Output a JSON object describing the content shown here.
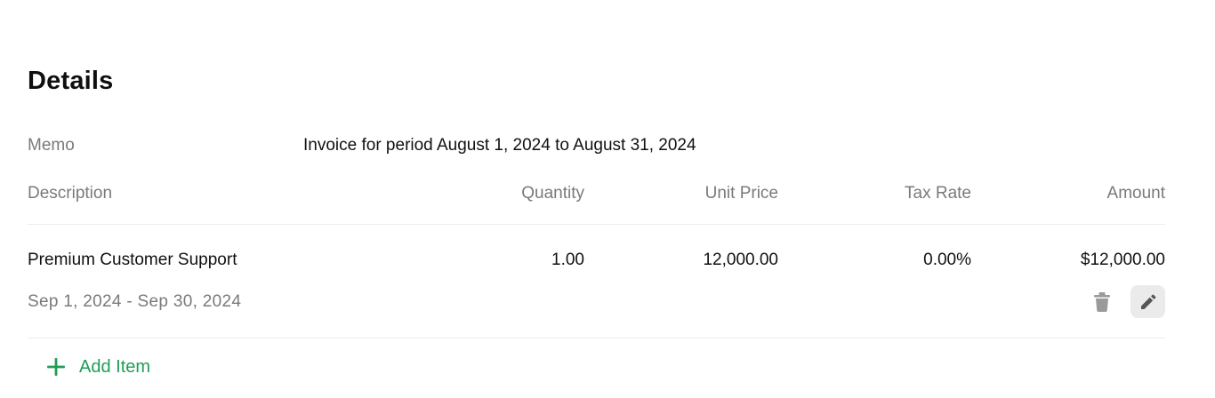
{
  "details": {
    "title": "Details",
    "memo_label": "Memo",
    "memo_value": "Invoice for period August 1, 2024 to August 31, 2024"
  },
  "table": {
    "columns": [
      "Description",
      "Quantity",
      "Unit Price",
      "Tax Rate",
      "Amount"
    ],
    "rows": [
      {
        "description": "Premium Customer Support",
        "quantity": "1.00",
        "unit_price": "12,000.00",
        "tax_rate": "0.00%",
        "amount": "$12,000.00",
        "period": "Sep 1, 2024 - Sep 30, 2024"
      }
    ]
  },
  "actions": {
    "delete_icon": "trash-icon",
    "edit_icon": "pencil-icon",
    "add_item_icon": "plus-icon",
    "add_item_label": "Add Item"
  },
  "colors": {
    "accent_green": "#1e9e55",
    "muted_text": "#7a7a7a",
    "icon_gray": "#9a9a9a",
    "edit_button_bg": "#ebebeb"
  }
}
